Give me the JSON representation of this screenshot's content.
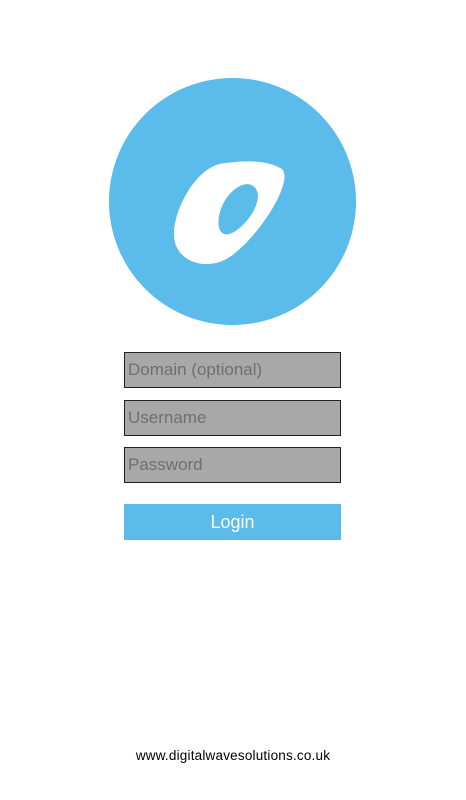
{
  "app": {
    "logo_icon": "o-logo-icon"
  },
  "colors": {
    "accent": "#5bbbea",
    "field_background": "#a8a8a8",
    "field_border": "#222222",
    "background": "#ffffff"
  },
  "form": {
    "domain_placeholder": "Domain (optional)",
    "username_placeholder": "Username",
    "password_placeholder": "Password",
    "domain_value": "",
    "username_value": "",
    "password_value": ""
  },
  "login_button": {
    "label": "Login"
  },
  "footer": {
    "website": "www.digitalwavesolutions.co.uk"
  }
}
